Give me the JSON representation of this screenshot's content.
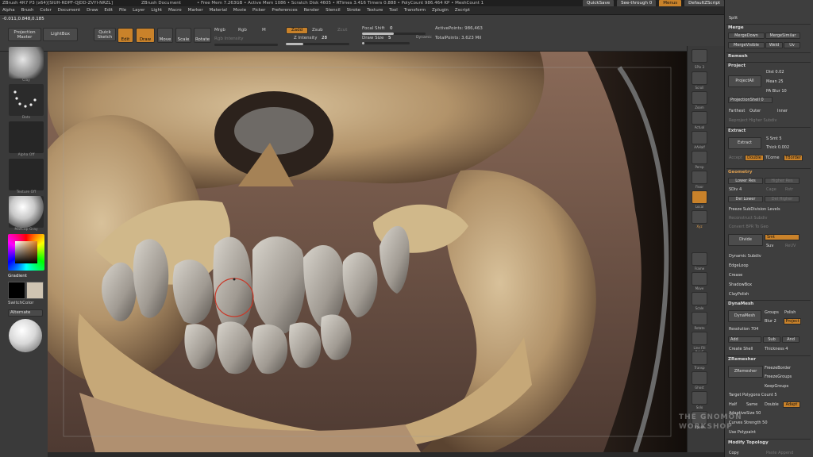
{
  "title_bar": {
    "app": "ZBrush 4R7 P3 (x64)[SIUH-RDPF-QJDD-ZVYI-NRZL]",
    "document": "ZBrush Document",
    "stats": "• Free Mem 7.263GB • Active Mem 1086 • Scratch Disk 4605 • RTimes 3.416 Timers 0.888 • PolyCount 986.464 KP • MeshCount 1"
  },
  "title_right": {
    "quicksave": "QuickSave",
    "seethrough": "See-through 0",
    "menus": "Menus",
    "script": "DefaultZScript"
  },
  "menus": [
    "Alpha",
    "Brush",
    "Color",
    "Document",
    "Draw",
    "Edit",
    "File",
    "Layer",
    "Light",
    "Macro",
    "Marker",
    "Material",
    "Movie",
    "Picker",
    "Preferences",
    "Render",
    "Stencil",
    "Stroke",
    "Texture",
    "Tool",
    "Transform",
    "Zplugin",
    "Zscript"
  ],
  "coords": "-0.011,0.848,0.185",
  "toolbar": {
    "projection_master": "Projection Master",
    "lightbox": "LightBox",
    "quick_sketch": "Quick Sketch",
    "edit": "Edit",
    "draw": "Draw",
    "move": "Move",
    "scale": "Scale",
    "rotate": "Rotate",
    "mrgb": "Mrgb",
    "rgb": "Rgb",
    "m": "M",
    "rgb_intensity": "Rgb Intensity",
    "zadd": "Zadd",
    "zsub": "Zsub",
    "zcut": "Zcut",
    "z_intensity_label": "Z Intensity",
    "z_intensity_value": "28",
    "focal_shift_label": "Focal Shift",
    "focal_shift_value": "0",
    "draw_size_label": "Draw Size",
    "draw_size_value": "5",
    "dynamic": "Dynamic",
    "active_points": "ActivePoints: 986,463",
    "total_points": "TotalPoints: 3.623 Mil"
  },
  "left_shelf": {
    "brush_label": "Clay",
    "stroke_label": "Dots",
    "alpha_label": "Alpha Off",
    "texture_label": "Texture Off",
    "material_label": "MatCap Gray",
    "gradient_label": "Gradient",
    "switch_color": "SwitchColor",
    "alternate": "Alternate"
  },
  "right_shelf": [
    "Bpr",
    "SPix 3",
    "Scroll",
    "Zoom",
    "Actual",
    "AAHalf",
    "Persp",
    "Floor",
    "Local",
    "L.Sym",
    "Xyz",
    "Frame",
    "Move",
    "Scale",
    "Rotate",
    "Line Fill PolyF",
    "Transp",
    "Ghost",
    "Solo",
    "Xpose"
  ],
  "tray": {
    "split": "Split",
    "merge_title": "Merge",
    "merge_down": "MergeDown",
    "merge_similar": "MergeSimilar",
    "merge_visible": "MergeVisible",
    "weld": "Weld",
    "uv": "Uv",
    "remesh_title": "Remesh",
    "project_title": "Project",
    "project_all": "ProjectAll",
    "dist": "Dist 0.02",
    "mean": "Mean 25",
    "pa_blur": "PA Blur 10",
    "projection_shell": "ProjectionShell 0",
    "farthest": "Farthest",
    "outer": "Outer",
    "inner": "Inner",
    "reproject": "Reproject Higher Subdiv",
    "extract_title": "Extract",
    "extract": "Extract",
    "s_smt": "S Smt 5",
    "thick": "Thick 0.002",
    "accept": "Accept",
    "double": "Double",
    "tcorne": "TCorne",
    "tborder": "TBorder",
    "geometry_title": "Geometry",
    "lower_res": "Lower Res",
    "higher_res": "Higher Res",
    "sdiv": "SDiv 4",
    "cage": "Cage",
    "rstr": "Rstr",
    "del_lower": "Del Lower",
    "del_higher": "Del Higher",
    "freeze_subdiv": "Freeze SubDivision Levels",
    "reconstruct": "Reconstruct Subdiv",
    "convert_bpr": "Convert BPR To Geo",
    "divide": "Divide",
    "smt": "Smt",
    "suv": "Suv",
    "reuv": "ReUV",
    "dynamic_subdiv": "Dynamic Subdiv",
    "edgeloop": "EdgeLoop",
    "crease": "Crease",
    "shadowbox": "ShadowBox",
    "claypolish": "ClayPolish",
    "dynamesh_title": "DynaMesh",
    "dynamesh": "DynaMesh",
    "groups": "Groups",
    "polish": "Polish",
    "blur": "Blur 2",
    "project_btn": "Project",
    "resolution": "Resolution 704",
    "add": "Add",
    "sub": "Sub",
    "and": "And",
    "create_shell": "Create Shell",
    "thickness": "Thickness 4",
    "zremesher_title": "ZRemesher",
    "zremesher": "ZRemesher",
    "freeze_border": "FreezeBorder",
    "freeze_groups": "FreezeGroups",
    "keep_groups": "KeepGroups",
    "target_polys": "Target Polygons Count 5",
    "half": "Half",
    "same": "Same",
    "double2": "Double",
    "adapt": "Adapt",
    "adaptive_size": "AdaptiveSize 50",
    "curves_strength": "Curves Strength 50",
    "use_polypaint": "Use Polypaint",
    "modify_topology": "Modify Topology",
    "copy": "Copy",
    "paste_append": "Paste Append"
  },
  "watermark": "THE GNOMON WORKSHOP"
}
